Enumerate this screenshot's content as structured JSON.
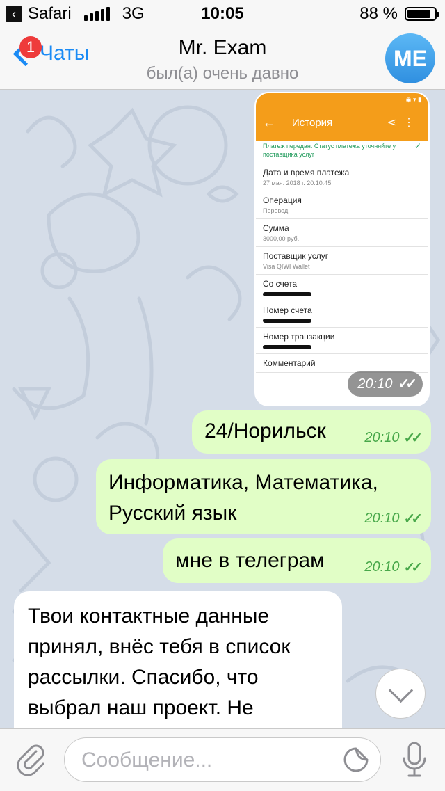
{
  "statusbar": {
    "app": "Safari",
    "network": "3G",
    "time": "10:05",
    "battery_text": "88 %",
    "battery_level": 0.88,
    "back_icon": "chevron-left-icon"
  },
  "nav": {
    "back_label": "Чаты",
    "badge": "1",
    "title": "Mr. Exam",
    "subtitle": "был(а) очень давно",
    "avatar_initials": "ME",
    "avatar_color": "#3a9ae8",
    "accent": "#1b8bf5"
  },
  "image_message": {
    "header_title": "История",
    "header_color": "#f49d1a",
    "status_note": "Платеж передан. Статус платежа уточняйте у поставщика услуг",
    "rows": [
      {
        "label": "Дата и время платежа",
        "value": "27 мая. 2018 г. 20:10:45"
      },
      {
        "label": "Операция",
        "value": "Перевод"
      },
      {
        "label": "Сумма",
        "value": "3000,00 руб."
      },
      {
        "label": "Поставщик услуг",
        "value": "Visa QIWI Wallet"
      },
      {
        "label": "Со счета",
        "value": ""
      },
      {
        "label": "Номер счета",
        "value": ""
      },
      {
        "label": "Номер транзакции",
        "value": ""
      },
      {
        "label": "Комментарий",
        "value": ""
      }
    ],
    "time": "20:10"
  },
  "messages": [
    {
      "text": "24/Норильск",
      "time": "20:10"
    },
    {
      "text": "Информатика, Математика, Русский язык",
      "time": "20:10"
    },
    {
      "text": "мне в телеграм",
      "time": "20:10"
    },
    {
      "text": "Твои контактные данные принял, внёс тебя в список рассылки. Спасибо, что выбрал наш проект. Не"
    }
  ],
  "input": {
    "placeholder": "Сообщение..."
  },
  "colors": {
    "outgoing_bubble": "#e1fec6",
    "incoming_bubble": "#ffffff",
    "read_ticks": "#48a84a",
    "chat_bg": "#d5dde8"
  }
}
